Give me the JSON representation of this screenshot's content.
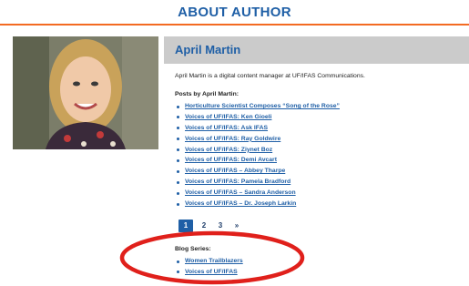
{
  "page": {
    "title": "ABOUT AUTHOR"
  },
  "author": {
    "name": "April Martin",
    "bio": "April Martin is a digital content manager at UF/IFAS Communications.",
    "posts_heading": "Posts by April Martin:",
    "posts": [
      "Horticulture Scientist Composes “Song of the Rose”",
      "Voices of UF/IFAS: Ken Gioeli",
      "Voices of UF/IFAS: Ask IFAS",
      "Voices of UF/IFAS: Ray Goldwire",
      "Voices of UF/IFAS: Ziynet Boz",
      "Voices of UF/IFAS: Demi Avcart",
      "Voices of UF/IFAS – Abbey Tharpe",
      "Voices of UF/IFAS: Pamela Bradford",
      "Voices of UF/IFAS – Sandra Anderson",
      "Voices of UF/IFAS – Dr. Joseph Larkin"
    ]
  },
  "pagination": {
    "pages": [
      "1",
      "2",
      "3"
    ],
    "next": "»",
    "current": "1"
  },
  "blog_series": {
    "heading": "Blog Series:",
    "items": [
      "Women Trailblazers",
      "Voices of UF/IFAS"
    ]
  },
  "colors": {
    "accent": "#1f5fa6",
    "rule": "#f36b22",
    "annotation": "#e0201b",
    "name_bar": "#cbcbcb"
  },
  "icons": {
    "bullet": "bullet-dot-icon"
  }
}
